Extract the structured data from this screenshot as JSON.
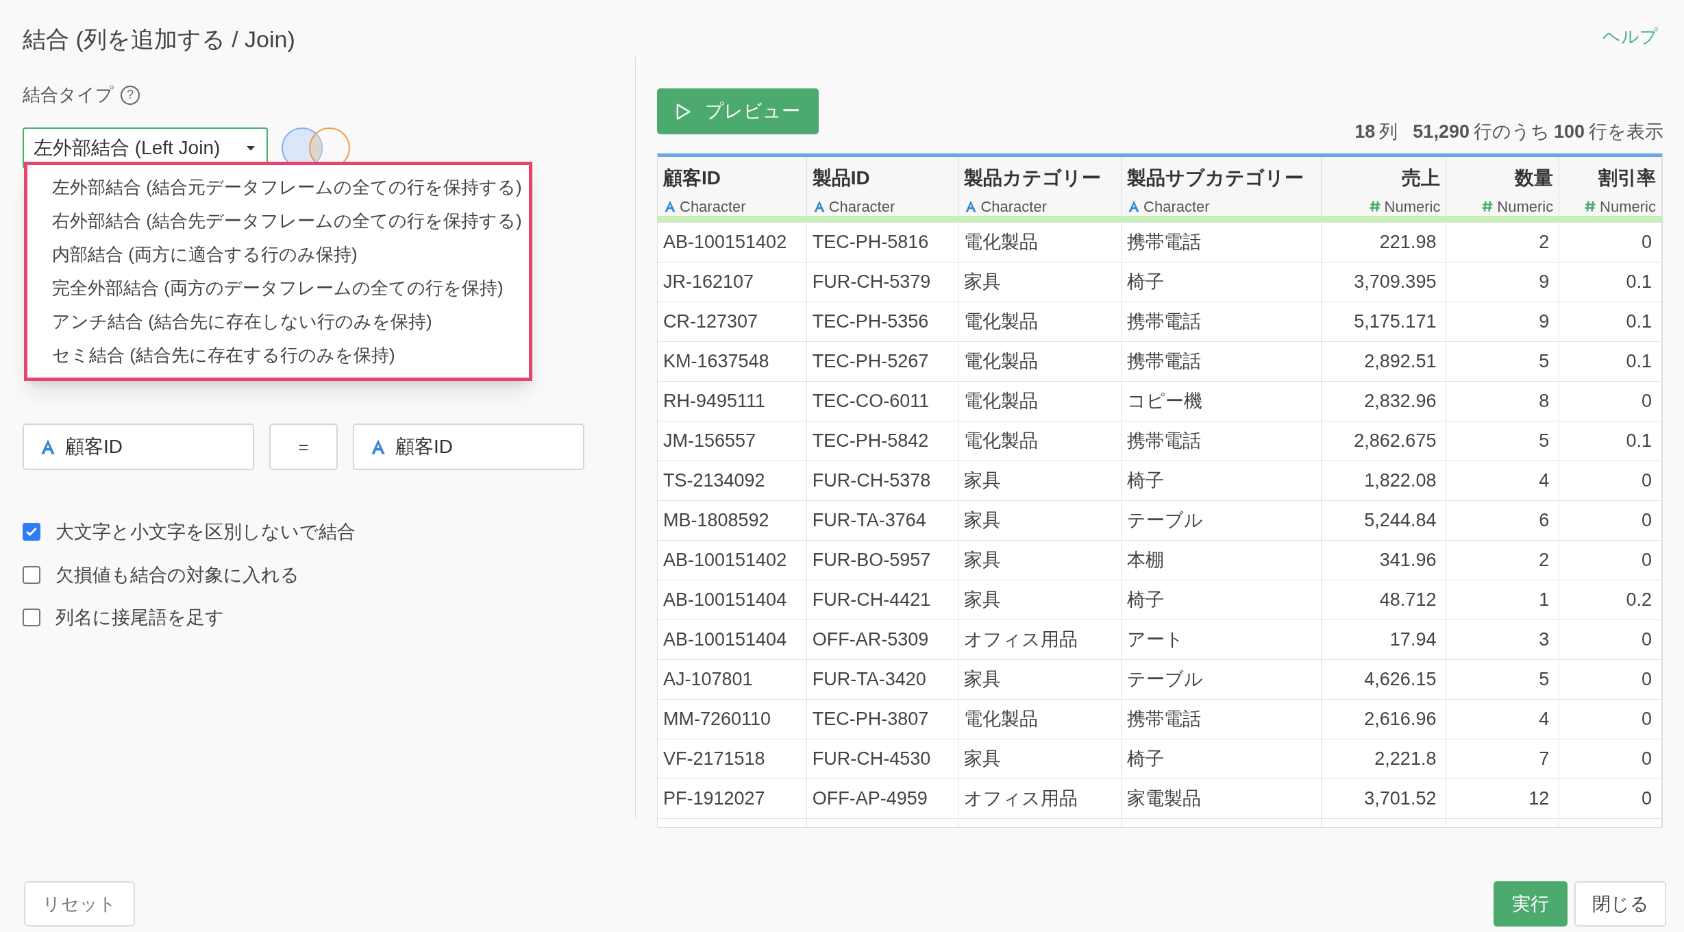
{
  "title": "結合 (列を追加する / Join)",
  "help_link": "ヘルプ",
  "join_type": {
    "label": "結合タイプ",
    "help": "?",
    "value": "左外部結合 (Left Join)",
    "options": [
      {
        "label": "左外部結合 (結合元データフレームの全ての行を保持する)"
      },
      {
        "label": "右外部結合 (結合先データフレームの全ての行を保持する)"
      },
      {
        "label": "内部結合 (両方に適合する行のみ保持)"
      },
      {
        "label": "完全外部結合 (両方のデータフレームの全ての行を保持)"
      },
      {
        "label": "アンチ結合 (結合先に存在しない行のみを保持)"
      },
      {
        "label": "セミ結合 (結合先に存在する行のみを保持)"
      }
    ]
  },
  "key": {
    "left": "顧客ID",
    "operator": "=",
    "right": "顧客ID"
  },
  "options": [
    {
      "label": "大文字と小文字を区別しないで結合",
      "checked": true
    },
    {
      "label": "欠損値も結合の対象に入れる",
      "checked": false
    },
    {
      "label": "列名に接尾語を足す",
      "checked": false
    }
  ],
  "reset_button": "リセット",
  "preview_button": "プレビュー",
  "summary": {
    "columns": "18",
    "columns_unit": "列",
    "rows": "51,290",
    "rows_text": "行のうち",
    "shown": "100",
    "shown_text": "行を表示"
  },
  "table": {
    "columns": [
      {
        "name": "顧客ID",
        "kind": "character",
        "type": "Character"
      },
      {
        "name": "製品ID",
        "kind": "character",
        "type": "Character"
      },
      {
        "name": "製品カテゴリー",
        "kind": "character",
        "type": "Character"
      },
      {
        "name": "製品サブカテゴリー",
        "kind": "character",
        "type": "Character"
      },
      {
        "name": "売上",
        "kind": "numeric",
        "type": "Numeric"
      },
      {
        "name": "数量",
        "kind": "numeric",
        "type": "Numeric"
      },
      {
        "name": "割引率",
        "kind": "numeric",
        "type": "Numeric"
      }
    ],
    "rows": [
      [
        "AB-100151402",
        "TEC-PH-5816",
        "電化製品",
        "携帯電話",
        "221.98",
        "2",
        "0"
      ],
      [
        "JR-162107",
        "FUR-CH-5379",
        "家具",
        "椅子",
        "3,709.395",
        "9",
        "0.1"
      ],
      [
        "CR-127307",
        "TEC-PH-5356",
        "電化製品",
        "携帯電話",
        "5,175.171",
        "9",
        "0.1"
      ],
      [
        "KM-1637548",
        "TEC-PH-5267",
        "電化製品",
        "携帯電話",
        "2,892.51",
        "5",
        "0.1"
      ],
      [
        "RH-9495111",
        "TEC-CO-6011",
        "電化製品",
        "コピー機",
        "2,832.96",
        "8",
        "0"
      ],
      [
        "JM-156557",
        "TEC-PH-5842",
        "電化製品",
        "携帯電話",
        "2,862.675",
        "5",
        "0.1"
      ],
      [
        "TS-2134092",
        "FUR-CH-5378",
        "家具",
        "椅子",
        "1,822.08",
        "4",
        "0"
      ],
      [
        "MB-1808592",
        "FUR-TA-3764",
        "家具",
        "テーブル",
        "5,244.84",
        "6",
        "0"
      ],
      [
        "AB-100151402",
        "FUR-BO-5957",
        "家具",
        "本棚",
        "341.96",
        "2",
        "0"
      ],
      [
        "AB-100151404",
        "FUR-CH-4421",
        "家具",
        "椅子",
        "48.712",
        "1",
        "0.2"
      ],
      [
        "AB-100151404",
        "OFF-AR-5309",
        "オフィス用品",
        "アート",
        "17.94",
        "3",
        "0"
      ],
      [
        "AJ-107801",
        "FUR-TA-3420",
        "家具",
        "テーブル",
        "4,626.15",
        "5",
        "0"
      ],
      [
        "MM-7260110",
        "TEC-PH-3807",
        "電化製品",
        "携帯電話",
        "2,616.96",
        "4",
        "0"
      ],
      [
        "VF-2171518",
        "FUR-CH-4530",
        "家具",
        "椅子",
        "2,221.8",
        "7",
        "0"
      ],
      [
        "PF-1912027",
        "OFF-AP-4959",
        "オフィス用品",
        "家電製品",
        "3,701.52",
        "12",
        "0"
      ]
    ]
  },
  "run_button": "実行",
  "close_button": "閉じる"
}
